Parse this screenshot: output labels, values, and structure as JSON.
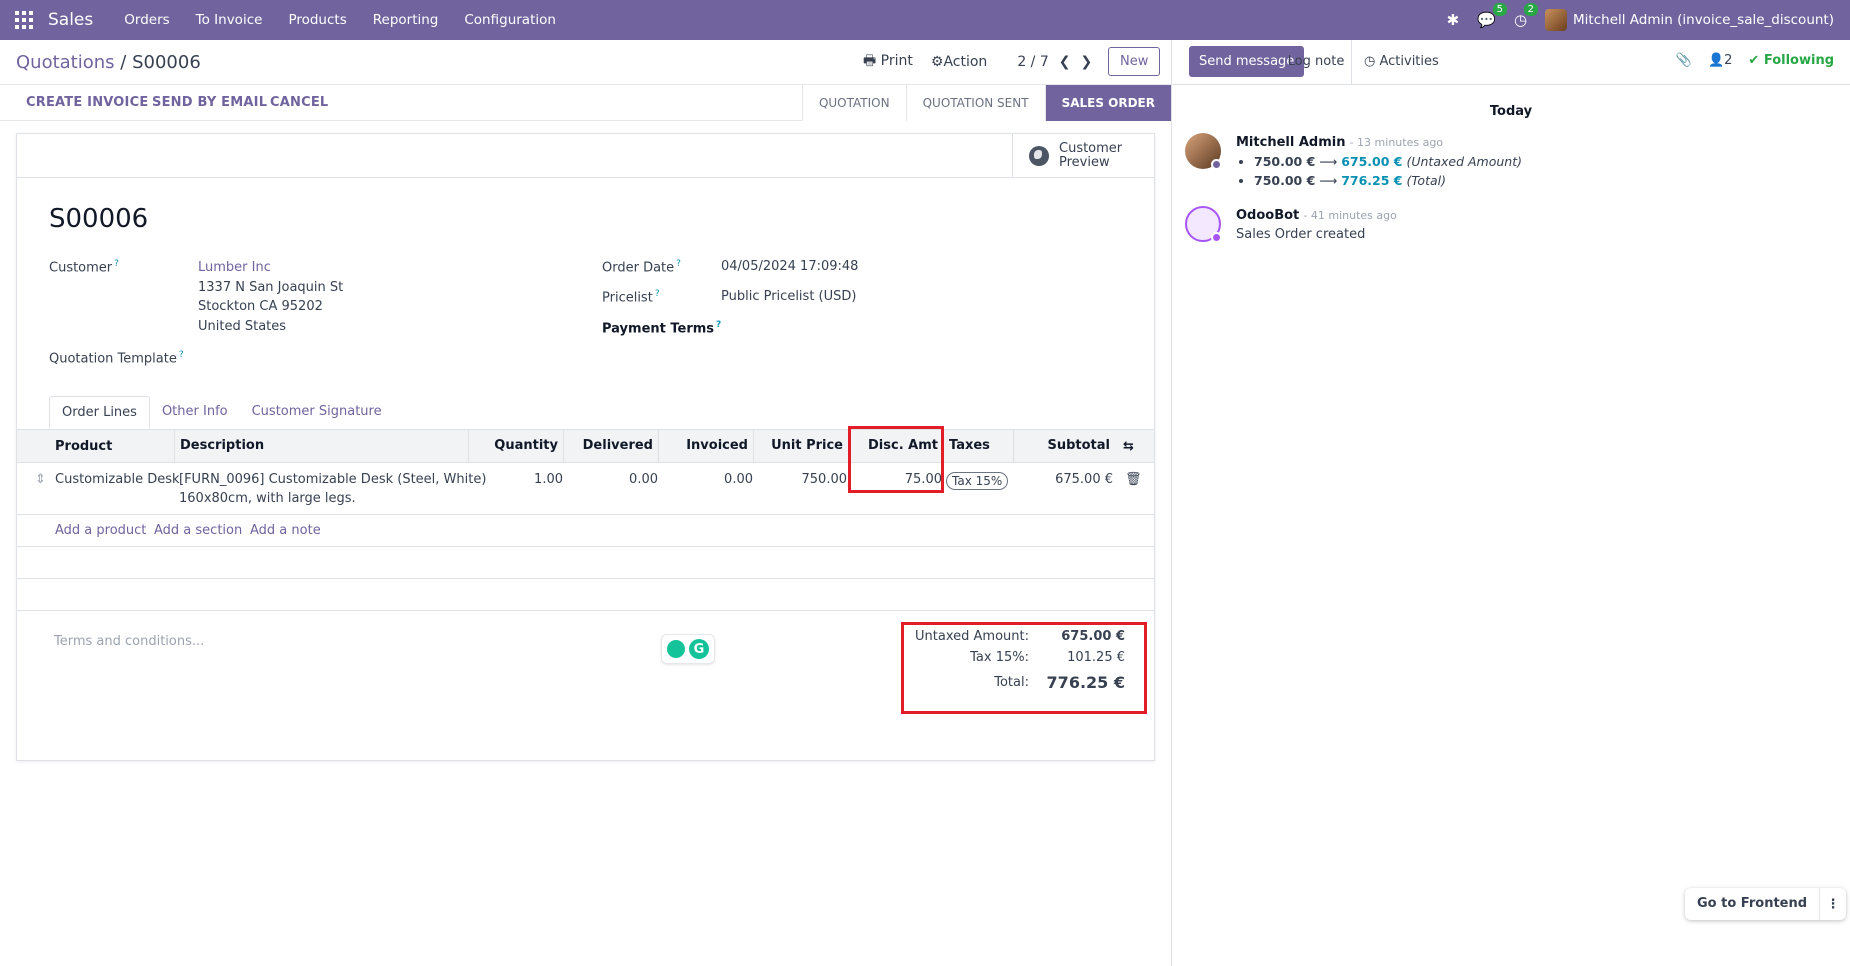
{
  "navbar": {
    "app_name": "Sales",
    "menu": [
      "Orders",
      "To Invoice",
      "Products",
      "Reporting",
      "Configuration"
    ],
    "messages_count": "5",
    "activities_count": "2",
    "user": "Mitchell Admin (invoice_sale_discount)",
    "icons": [
      "apps-grid-icon",
      "bug-icon",
      "chat-icon",
      "clock-icon"
    ]
  },
  "control": {
    "breadcrumb_parent": "Quotations",
    "breadcrumb_current": "S00006",
    "print": "Print",
    "action": "Action",
    "pager": "2 / 7",
    "new": "New"
  },
  "statusbar": {
    "buttons": [
      "CREATE INVOICE",
      "SEND BY EMAIL",
      "CANCEL"
    ],
    "stages": [
      "QUOTATION",
      "QUOTATION SENT",
      "SALES ORDER"
    ],
    "active_stage": "SALES ORDER"
  },
  "form": {
    "customer_preview": "Customer Preview",
    "name": "S00006",
    "customer_label": "Customer",
    "customer_name": "Lumber Inc",
    "address1": "1337 N San Joaquin St",
    "address2": "Stockton CA 95202",
    "address3": "United States",
    "template_label": "Quotation Template",
    "order_date_label": "Order Date",
    "order_date": "04/05/2024 17:09:48",
    "pricelist_label": "Pricelist",
    "pricelist": "Public Pricelist (USD)",
    "payment_terms_label": "Payment Terms",
    "tabs": [
      "Order Lines",
      "Other Info",
      "Customer Signature"
    ]
  },
  "table": {
    "headers": {
      "product": "Product",
      "description": "Description",
      "quantity": "Quantity",
      "delivered": "Delivered",
      "invoiced": "Invoiced",
      "unit_price": "Unit Price",
      "disc_amt": "Disc. Amt",
      "taxes": "Taxes",
      "subtotal": "Subtotal"
    },
    "rows": [
      {
        "product": "Customizable Desk",
        "description_1": "[FURN_0096] Customizable Desk (Steel, White)",
        "description_2": "160x80cm, with large legs.",
        "quantity": "1.00",
        "delivered": "0.00",
        "invoiced": "0.00",
        "unit_price": "750.00",
        "disc_amt": "75.00",
        "tax": "Tax 15%",
        "subtotal": "675.00 €"
      }
    ],
    "add_product": "Add a product",
    "add_section": "Add a section",
    "add_note": "Add a note"
  },
  "footer": {
    "terms_placeholder": "Terms and conditions...",
    "untaxed_label": "Untaxed Amount:",
    "untaxed_value": "675.00 €",
    "tax_label": "Tax 15%:",
    "tax_value": "101.25 €",
    "total_label": "Total:",
    "total_value": "776.25 €"
  },
  "chatter": {
    "send_message": "Send message",
    "log_note": "Log note",
    "activities": "Activities",
    "followers_count": "2",
    "following": "Following",
    "today": "Today",
    "messages": [
      {
        "author": "Mitchell Admin",
        "ago": "- 13 minutes ago",
        "tracking": [
          {
            "old": "750.00 €",
            "new": "675.00 €",
            "field": "(Untaxed Amount)"
          },
          {
            "old": "750.00 €",
            "new": "776.25 €",
            "field": "(Total)"
          }
        ]
      },
      {
        "author": "OdooBot",
        "ago": "- 41 minutes ago",
        "body": "Sales Order created"
      }
    ]
  },
  "go_frontend": "Go to Frontend",
  "colors": {
    "brand": "#71639e",
    "accent_teal": "#0891b2",
    "following_green": "#28a745",
    "highlight_red": "#e11d28"
  }
}
